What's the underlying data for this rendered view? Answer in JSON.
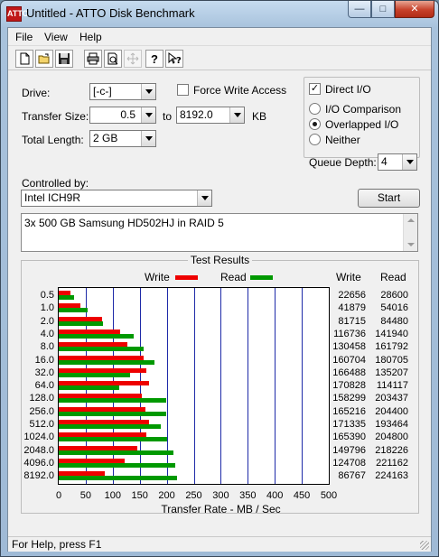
{
  "window": {
    "title": "Untitled - ATTO Disk Benchmark",
    "app_icon_text": "ATTO"
  },
  "menu": [
    "File",
    "View",
    "Help"
  ],
  "toolbar_icons": [
    "new-file-icon",
    "open-folder-icon",
    "save-icon",
    "print-icon",
    "print-preview-icon",
    "move-icon",
    "help-icon",
    "context-help-icon"
  ],
  "settings": {
    "drive_label": "Drive:",
    "drive_value": "[-c-]",
    "force_write_label": "Force Write Access",
    "force_write_checked": false,
    "direct_io_label": "Direct I/O",
    "direct_io_checked": true,
    "transfer_size_label": "Transfer Size:",
    "transfer_from": "0.5",
    "to_label": "to",
    "transfer_to": "8192.0",
    "unit": "KB",
    "total_length_label": "Total Length:",
    "total_length_value": "2 GB",
    "io_options": [
      {
        "label": "I/O Comparison",
        "selected": false
      },
      {
        "label": "Overlapped I/O",
        "selected": true
      },
      {
        "label": "Neither",
        "selected": false
      }
    ],
    "queue_depth_label": "Queue Depth:",
    "queue_depth_value": "4",
    "controlled_by_label": "Controlled by:",
    "controller_value": "Intel ICH9R",
    "start_label": "Start",
    "description": "3x 500 GB Samsung HD502HJ in RAID 5"
  },
  "chart_data": {
    "type": "bar",
    "title": "Test Results",
    "xlabel": "Transfer Rate - MB / Sec",
    "xlim": [
      0,
      500
    ],
    "xticks": [
      0,
      50,
      100,
      150,
      200,
      250,
      300,
      350,
      400,
      450,
      500
    ],
    "legend": {
      "write_label": "Write",
      "read_label": "Read",
      "write_color": "#ee0000",
      "read_color": "#009900"
    },
    "column_headers": {
      "write": "Write",
      "read": "Read"
    },
    "categories": [
      "0.5",
      "1.0",
      "2.0",
      "4.0",
      "8.0",
      "16.0",
      "32.0",
      "64.0",
      "128.0",
      "256.0",
      "512.0",
      "1024.0",
      "2048.0",
      "4096.0",
      "8192.0"
    ],
    "series": [
      {
        "name": "Write",
        "values": [
          22656,
          41879,
          81715,
          116736,
          130458,
          160704,
          166488,
          170828,
          158299,
          165216,
          171335,
          165390,
          149796,
          124708,
          86767
        ]
      },
      {
        "name": "Read",
        "values": [
          28600,
          54016,
          84480,
          141940,
          161792,
          180705,
          135207,
          114117,
          203437,
          204400,
          193464,
          204800,
          218226,
          221162,
          224163
        ]
      }
    ]
  },
  "status": {
    "text": "For Help, press F1"
  }
}
